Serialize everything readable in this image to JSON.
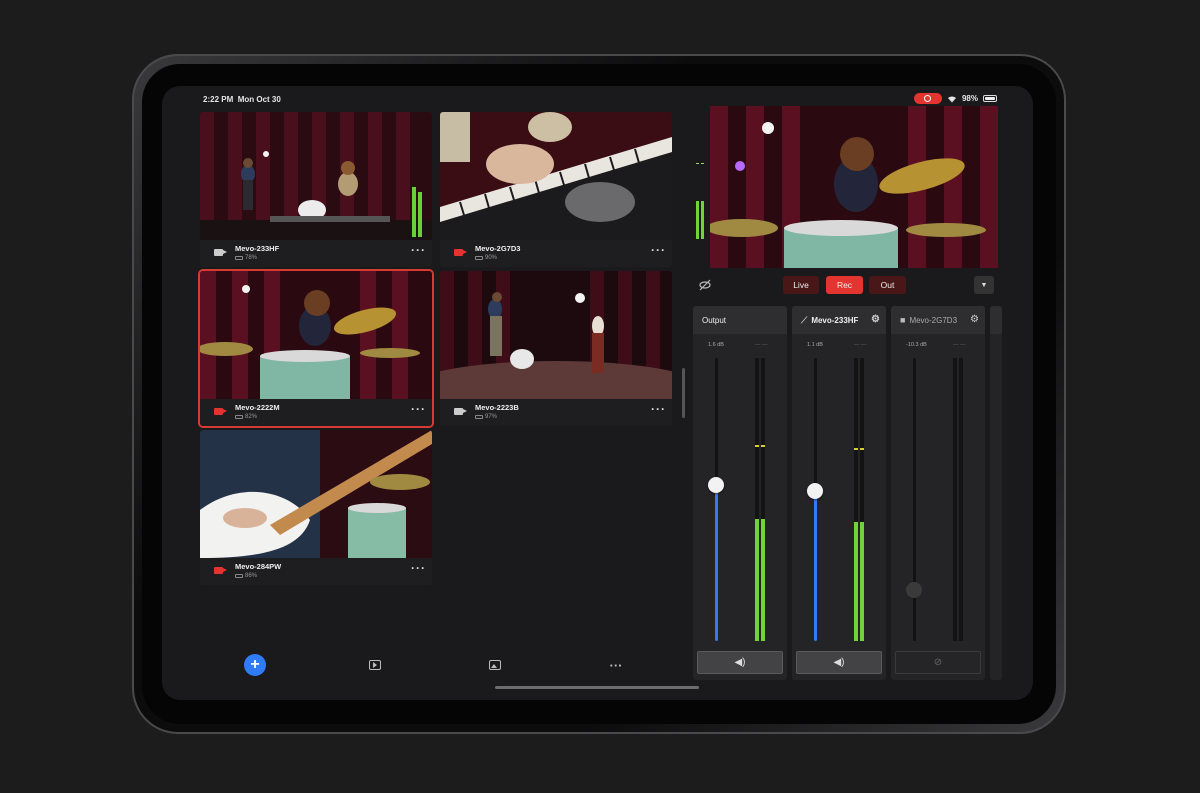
{
  "status_bar": {
    "time": "2:22 PM",
    "date": "Mon Oct 30",
    "battery": "98%"
  },
  "cameras": [
    {
      "name": "Mevo-233HF",
      "battery": "78%",
      "recording": false,
      "selected": false
    },
    {
      "name": "Mevo-2G7D3",
      "battery": "90%",
      "recording": true,
      "selected": false
    },
    {
      "name": "Mevo-2222M",
      "battery": "82%",
      "recording": true,
      "selected": true
    },
    {
      "name": "Mevo-2223B",
      "battery": "97%",
      "recording": false,
      "selected": false
    },
    {
      "name": "Mevo-284PW",
      "battery": "86%",
      "recording": true,
      "selected": false
    }
  ],
  "bottom_toolbar": {
    "add": "+",
    "more": "···"
  },
  "modes": {
    "live": "Live",
    "rec": "Rec",
    "out": "Out",
    "active": "Rec"
  },
  "mixer": {
    "output": {
      "label": "Output",
      "db": "1.6 dB",
      "level": "— —",
      "fader": 0.55,
      "meter": 0.43,
      "peak": 0.69
    },
    "ch1": {
      "label": "Mevo-233HF",
      "db": "1.1 dB",
      "level": "— —",
      "fader": 0.53,
      "meter": 0.42,
      "peak": 0.68
    },
    "ch2": {
      "label": "Mevo-2G7D3",
      "db": "-10.3 dB",
      "level": "— —",
      "fader": 0.18,
      "meter": 0.0,
      "peak": 0.0
    }
  },
  "colors": {
    "accent_blue": "#2f7cf6",
    "record_red": "#e3342f",
    "meter_green": "#72d337"
  },
  "icons": {
    "camera": "video-camera-icon",
    "more": "ellipsis-icon",
    "add": "plus-icon",
    "library": "play-library-icon",
    "media": "image-icon",
    "speaker": "speaker-icon",
    "mute": "muted-speaker-icon",
    "settings": "gear-icon",
    "dropdown": "chevron-down-icon"
  }
}
